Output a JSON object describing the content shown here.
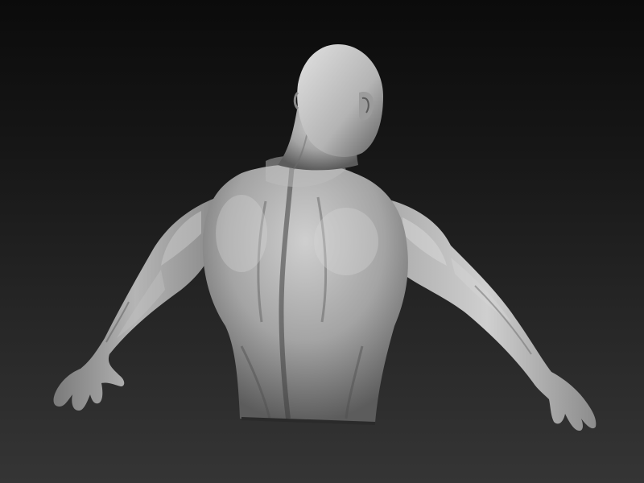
{
  "scene": {
    "subject": "sculpted-male-torso-back-view",
    "colors": {
      "background_top": "#0b0b0b",
      "background_bottom": "#353535",
      "clay_light": "#c9c9c9",
      "clay_mid": "#9a9a9a",
      "clay_dark": "#4a4a4a"
    }
  }
}
